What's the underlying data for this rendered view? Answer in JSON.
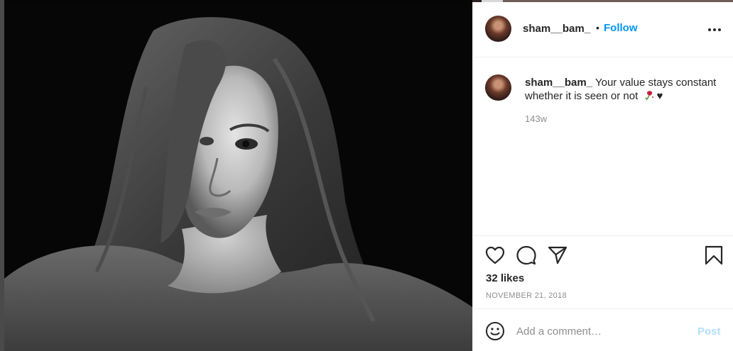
{
  "post": {
    "username": "sham__bam_",
    "header_separator": "•",
    "follow_label": "Follow",
    "caption": "Your value stays constant whether it is seen or not",
    "caption_emoji_suffix": "♥",
    "time_ago": "143w",
    "likes": "32 likes",
    "date": "NOVEMBER 21, 2018"
  },
  "comment": {
    "placeholder": "Add a comment…",
    "post_label": "Post"
  },
  "icons": {
    "options": "more-horizontal-icon",
    "like": "heart-outline-icon",
    "comment": "speech-bubble-icon",
    "share": "paper-plane-icon",
    "save": "bookmark-icon",
    "emoji": "smiley-icon",
    "caption_emoji": "wilted-rose-icon"
  },
  "colors": {
    "link_blue": "#0095f6",
    "post_disabled": "#b2dffc",
    "text_primary": "#262626",
    "text_secondary": "#8e8e8e",
    "divider": "#efefef"
  }
}
